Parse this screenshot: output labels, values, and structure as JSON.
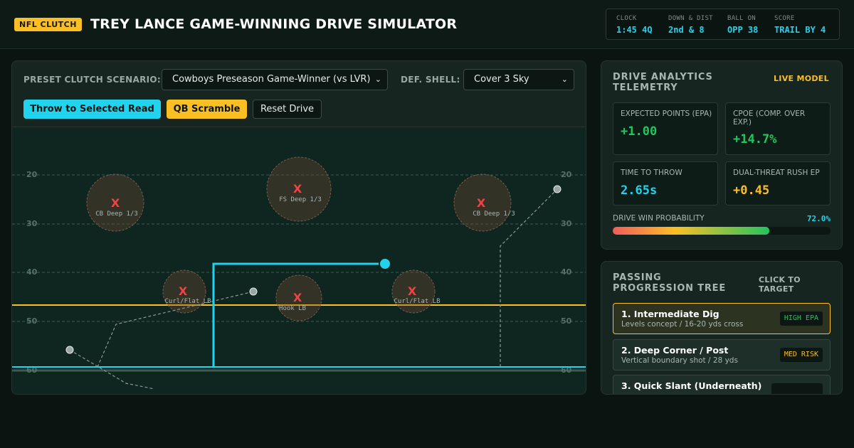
{
  "header": {
    "badge": "NFL CLUTCH",
    "title": "TREY LANCE GAME-WINNING DRIVE SIMULATOR",
    "scoreboard": [
      {
        "label": "CLOCK",
        "value": "1:45 4Q"
      },
      {
        "label": "DOWN & DIST",
        "value": "2nd & 8"
      },
      {
        "label": "BALL ON",
        "value": "OPP 38"
      },
      {
        "label": "SCORE",
        "value": "TRAIL BY 4"
      }
    ]
  },
  "controls": {
    "scenario_label": "PRESET CLUTCH SCENARIO:",
    "scenario_value": "Cowboys Preseason Game-Winner (vs LVR)",
    "shell_label": "DEF. SHELL:",
    "shell_value": "Cover 3 Sky",
    "throw_button": "Throw to Selected Read",
    "scramble_button": "QB Scramble",
    "reset_button": "Reset Drive"
  },
  "field": {
    "yard_numbers": [
      "20",
      "30",
      "40",
      "50",
      "60"
    ],
    "defenders": [
      {
        "mark": "X",
        "label": "CB Deep 1/3"
      },
      {
        "mark": "X",
        "label": "FS Deep 1/3"
      },
      {
        "mark": "X",
        "label": "CB Deep 1/3"
      },
      {
        "mark": "X",
        "label": "Curl/Flat LB"
      },
      {
        "mark": "X",
        "label": "Hook LB"
      },
      {
        "mark": "X",
        "label": "Curl/Flat LB"
      }
    ],
    "colors": {
      "route_selected": "#22d3ee",
      "line_of_scrimmage": "#fbbf24",
      "first_down": "#22d3ee",
      "defender": "#ef4444"
    }
  },
  "telemetry": {
    "title": "DRIVE ANALYTICS TELEMETRY",
    "tag": "LIVE MODEL",
    "metrics": [
      {
        "label": "EXPECTED POINTS (EPA)",
        "value": "+1.00",
        "color": "#22c55e"
      },
      {
        "label": "CPOE (COMP. OVER EXP.)",
        "value": "+14.7%",
        "color": "#22c55e"
      },
      {
        "label": "TIME TO THROW",
        "value": "2.65s",
        "color": "#22d3ee"
      },
      {
        "label": "DUAL-THREAT RUSH EP",
        "value": "+0.45",
        "color": "#fbbf24"
      }
    ],
    "win_prob_label": "DRIVE WIN PROBABILITY",
    "win_prob_value": "72.0%",
    "win_prob_fraction": 0.72
  },
  "progression": {
    "title": "PASSING PROGRESSION TREE",
    "tag": "CLICK TO TARGET",
    "reads": [
      {
        "title": "1. Intermediate Dig",
        "subtitle": "Levels concept / 16-20 yds cross",
        "badge": "HIGH EPA",
        "badge_color": "#22c55e",
        "selected": true
      },
      {
        "title": "2. Deep Corner / Post",
        "subtitle": "Vertical boundary shot / 28 yds",
        "badge": "MED RISK",
        "badge_color": "#fbbf24",
        "selected": false
      },
      {
        "title": "3. Quick Slant (Underneath)",
        "subtitle": "",
        "badge": "",
        "badge_color": "#22c55e",
        "selected": false
      }
    ]
  }
}
